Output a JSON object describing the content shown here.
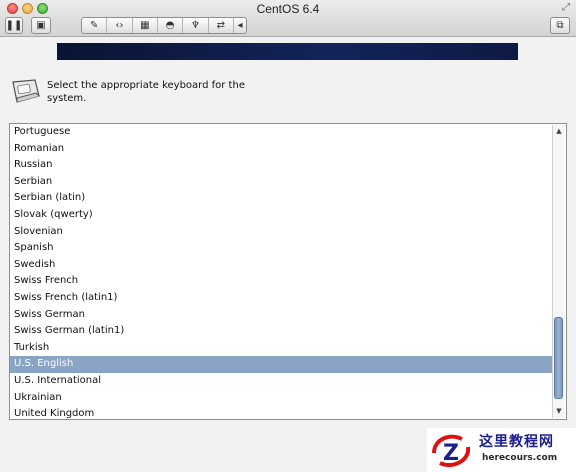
{
  "window": {
    "title": "CentOS 6.4"
  },
  "toolbar": {
    "pause_icon": "pause-icon",
    "snapshot_icon": "snapshot-icon",
    "tools": [
      "wrench-icon",
      "network-arrows-icon",
      "image-icon",
      "disk-icon",
      "usb-icon",
      "sharing-icon",
      "collapse-arrow-icon"
    ],
    "right_icon": "window-resize-icon"
  },
  "banner": {
    "color": "#12245a"
  },
  "prompt": {
    "text": "Select the appropriate keyboard for the system."
  },
  "keyboard_list": {
    "items": [
      "Portuguese",
      "Romanian",
      "Russian",
      "Serbian",
      "Serbian (latin)",
      "Slovak (qwerty)",
      "Slovenian",
      "Spanish",
      "Swedish",
      "Swiss French",
      "Swiss French (latin1)",
      "Swiss German",
      "Swiss German (latin1)",
      "Turkish",
      "U.S. English",
      "U.S. International",
      "Ukrainian",
      "United Kingdom"
    ],
    "selected": "U.S. English",
    "selection_color": "#8aa4c6"
  },
  "watermark": {
    "cn_text": "这里教程网",
    "url": "herecours.com"
  }
}
